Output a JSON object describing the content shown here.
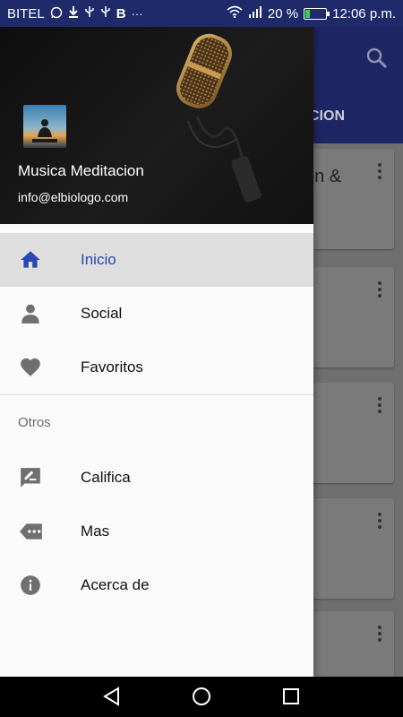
{
  "status_bar": {
    "carrier": "BITEL",
    "notification_icons": [
      "whatsapp-icon",
      "download-icon",
      "usb-icon",
      "usb-icon",
      "b-icon",
      "more-icon"
    ],
    "battery_percent": "20 %",
    "battery_level": 0.2,
    "time": "12:06 p.m."
  },
  "app_background": {
    "tab_label": "CION",
    "card_title_fragment": "on &"
  },
  "drawer": {
    "app_name": "Musica Meditacion",
    "email": "info@elbiologo.com",
    "primary_items": [
      {
        "label": "Inicio",
        "icon": "home-icon",
        "active": true
      },
      {
        "label": "Social",
        "icon": "person-icon",
        "active": false
      },
      {
        "label": "Favoritos",
        "icon": "heart-icon",
        "active": false
      }
    ],
    "section_label": "Otros",
    "secondary_items": [
      {
        "label": "Califica",
        "icon": "rate-review-icon"
      },
      {
        "label": "Mas",
        "icon": "more-tag-icon"
      },
      {
        "label": "Acerca de",
        "icon": "info-icon"
      }
    ]
  },
  "colors": {
    "accent": "#2947b5",
    "toolbar": "#1e2763",
    "status_bar": "#1f2a6b",
    "active_item_bg": "#dedede"
  }
}
